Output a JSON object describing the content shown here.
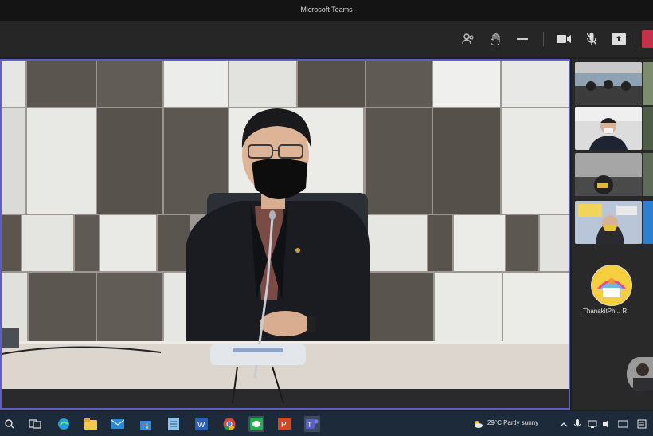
{
  "window": {
    "title": "Microsoft Teams"
  },
  "toolbar": {
    "icons": [
      "people-icon",
      "raise-hand-icon",
      "more-icon",
      "camera-icon",
      "mic-off-icon",
      "share-icon"
    ]
  },
  "side_panel": {
    "participant_name": "ThanakitPh... R",
    "avatar_initials": ""
  },
  "taskbar": {
    "weather_text": "29°C  Partly sunny"
  },
  "colors": {
    "accent": "#5b5fc7",
    "leave": "#c4314b",
    "taskbar": "#1c2a39"
  }
}
